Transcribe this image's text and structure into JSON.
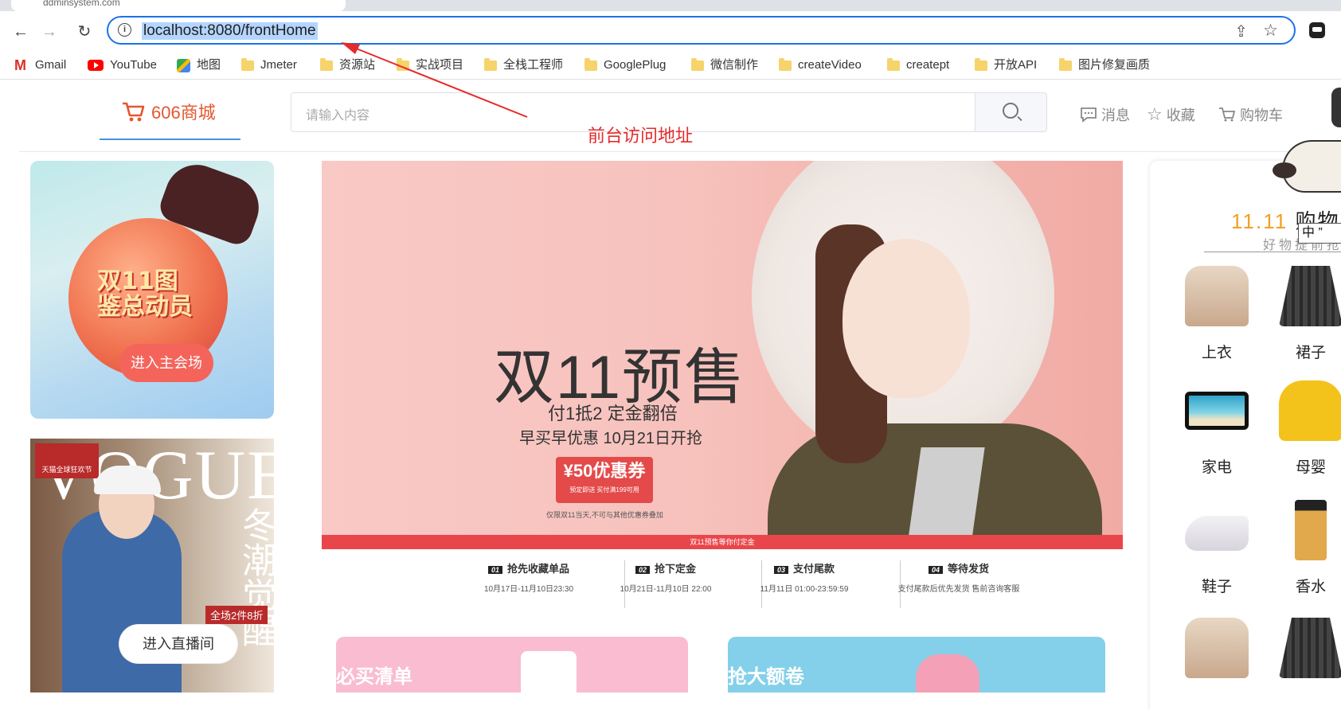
{
  "browser": {
    "tab_title": "ddminsystem.com",
    "url": "localhost:8080/frontHome",
    "bookmarks": [
      {
        "label": "Gmail",
        "icon": "gmail-icon"
      },
      {
        "label": "YouTube",
        "icon": "youtube-icon"
      },
      {
        "label": "地图",
        "icon": "maps-icon"
      },
      {
        "label": "Jmeter",
        "icon": "folder-icon"
      },
      {
        "label": "资源站",
        "icon": "folder-icon"
      },
      {
        "label": "实战项目",
        "icon": "folder-icon"
      },
      {
        "label": "全栈工程师",
        "icon": "folder-icon"
      },
      {
        "label": "GooglePlug",
        "icon": "folder-icon"
      },
      {
        "label": "微信制作",
        "icon": "folder-icon"
      },
      {
        "label": "createVideo",
        "icon": "folder-icon"
      },
      {
        "label": "creatept",
        "icon": "folder-icon"
      },
      {
        "label": "开放API",
        "icon": "folder-icon"
      },
      {
        "label": "图片修复画质",
        "icon": "folder-icon"
      }
    ]
  },
  "header": {
    "logo_text": "606商城",
    "search_placeholder": "请输入内容",
    "nav": [
      {
        "label": "消息",
        "icon": "message-icon"
      },
      {
        "label": "收藏",
        "icon": "star-icon"
      },
      {
        "label": "购物车",
        "icon": "cart-icon"
      }
    ],
    "accent_color": "#e4572e"
  },
  "annotation": {
    "text": "前台访问地址",
    "color": "#e52b2b"
  },
  "left_cards": {
    "card1_title": "双11图鉴总动员",
    "card1_button": "进入主会场",
    "card2_brand": "VOGUE",
    "card2_tag": "天猫全球狂欢节",
    "card2_headline": "冬潮觉醒",
    "card2_sale": "全场2件8折",
    "card2_button": "进入直播间"
  },
  "banner": {
    "headline": "双11预售",
    "subline1": "付1抵2 定金翻倍",
    "subline2": "早买早优惠 10月21日开抢",
    "coupon_amount": "¥50优惠券",
    "coupon_note": "预定即送 买付满199可用",
    "fine_print": "仅限双11当天,不可与其他优惠券叠加",
    "bar_text": "双11预售等你付定金",
    "steps": [
      {
        "num": "01",
        "title": "抢先收藏单品",
        "date": "10月17日-11月10日23:30"
      },
      {
        "num": "02",
        "title": "抢下定金",
        "date": "10月21日-11月10日 22:00"
      },
      {
        "num": "03",
        "title": "支付尾款",
        "date": "11月11日 01:00-23:59:59"
      },
      {
        "num": "04",
        "title": "等待发货",
        "date": "支付尾款后优先发货 售前咨询客服"
      }
    ]
  },
  "promos": [
    {
      "title": "必买清单"
    },
    {
      "title": "抢大额卷"
    }
  ],
  "category_panel": {
    "title_accent": "11.11",
    "title_rest": "购物",
    "subtitle": "好物提前抢",
    "items": [
      {
        "label": "上衣"
      },
      {
        "label": "裙子"
      },
      {
        "label": "家电"
      },
      {
        "label": "母婴"
      },
      {
        "label": "鞋子"
      },
      {
        "label": "香水"
      }
    ]
  },
  "ime_indicator": "中 ”"
}
